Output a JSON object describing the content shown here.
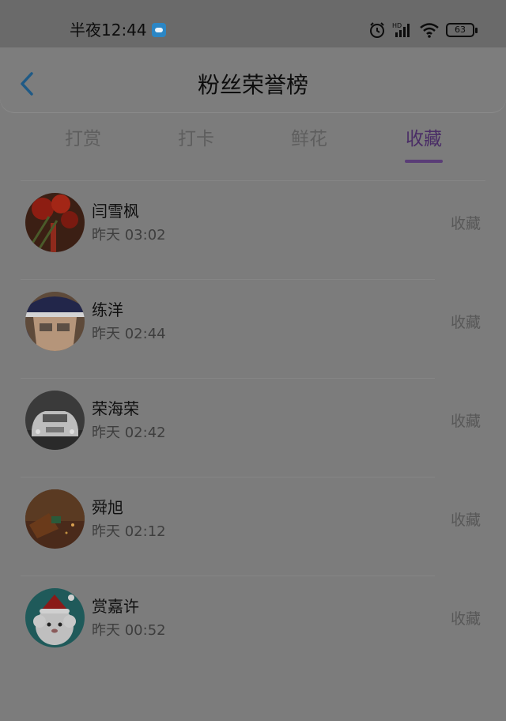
{
  "status_bar": {
    "time": "半夜12:44",
    "battery": "63",
    "hd_label": "HD"
  },
  "header": {
    "title": "粉丝荣誉榜"
  },
  "tabs": [
    {
      "label": "打赏",
      "active": false
    },
    {
      "label": "打卡",
      "active": false
    },
    {
      "label": "鲜花",
      "active": false
    },
    {
      "label": "收藏",
      "active": true
    }
  ],
  "fans": [
    {
      "name": "闫雪枫",
      "time": "昨天 03:02",
      "action": "收藏",
      "avatar": "red-flowers-avatar"
    },
    {
      "name": "练洋",
      "time": "昨天 02:44",
      "action": "收藏",
      "avatar": "anime-character-avatar"
    },
    {
      "name": "荣海荣",
      "time": "昨天 02:42",
      "action": "收藏",
      "avatar": "white-car-avatar"
    },
    {
      "name": "舜旭",
      "time": "昨天 02:12",
      "action": "收藏",
      "avatar": "dark-scene-avatar"
    },
    {
      "name": "赏嘉许",
      "time": "昨天 00:52",
      "action": "收藏",
      "avatar": "christmas-sheep-avatar"
    }
  ],
  "colors": {
    "overlay_bg": "#7c7c7c",
    "active_tab": "#5a3d77",
    "back_arrow": "#1f5a86"
  }
}
